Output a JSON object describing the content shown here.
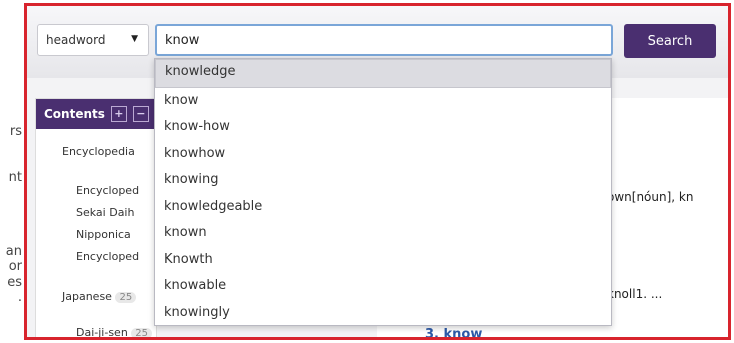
{
  "edge_fragments": [
    "rs",
    "nt",
    "an",
    "or",
    "es",
    "."
  ],
  "search": {
    "scope": "headword",
    "query": "know",
    "button_label": "Search"
  },
  "suggestions": [
    "knowledge",
    "know",
    "know-how",
    "knowhow",
    "knowing",
    "knowledgeable",
    "known",
    "Knowth",
    "knowable",
    "knowingly"
  ],
  "contents": {
    "title": "Contents",
    "expand": "+",
    "collapse": "−",
    "items": [
      {
        "label": "Encyclopedia"
      },
      {
        "label": "Encycloped"
      },
      {
        "label": "Sekai Daih"
      },
      {
        "label": "Nipponica"
      },
      {
        "label": "Encycloped"
      },
      {
        "label": "Japanese",
        "count": "25"
      },
      {
        "label": "Dai-ji-sen",
        "count": "25"
      }
    ]
  },
  "results": {
    "snippet1": "own[nóun], kn",
    "snippet2": "knoll1. ...",
    "link3": "3. know"
  }
}
